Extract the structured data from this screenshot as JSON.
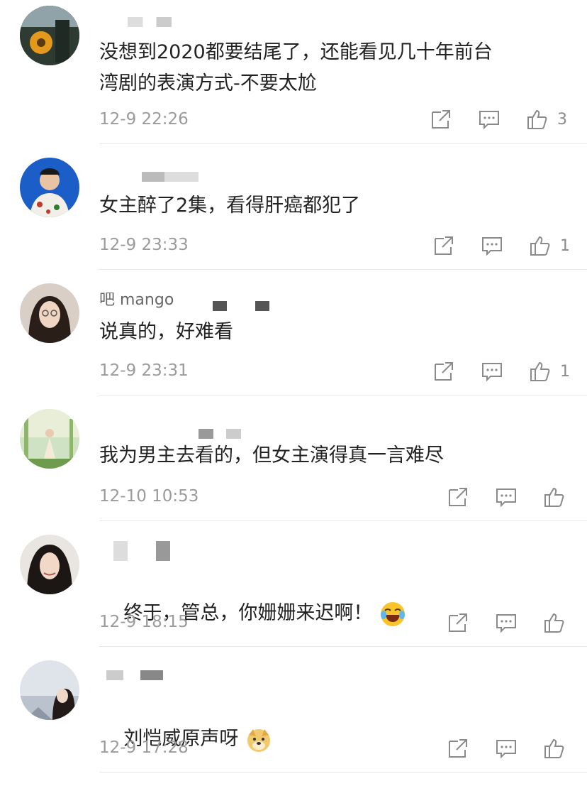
{
  "comments": [
    {
      "text": "没想到2020都要结尾了，还能看见几十年前台\n湾剧的表演方式-不要太尬",
      "time": "12-9 22:26",
      "likes": "3",
      "avatar": "sunflower"
    },
    {
      "text": "女主醉了2集，看得肝癌都犯了",
      "time": "12-9 23:33",
      "likes": "1",
      "avatar": "man"
    },
    {
      "text": "说真的，好难看",
      "time": "12-9 23:31",
      "likes": "1",
      "avatar": "woman-glasses",
      "name_fragment": "吧 mango"
    },
    {
      "text": "我为男主去看的，但女主演得真一言难尽",
      "time": "12-10 10:53",
      "likes": "",
      "avatar": "garden"
    },
    {
      "text": "终于，管总，你姗姗来迟啊！",
      "time": "12-9 18:15",
      "likes": "",
      "avatar": "woman-hair",
      "emoji": "laugh-cry"
    },
    {
      "text": "刘恺威原声呀",
      "time": "12-9 17:28",
      "likes": "",
      "avatar": "woman-outdoor",
      "emoji": "doge"
    }
  ],
  "icons": {
    "share": "share-icon",
    "reply": "comment-icon",
    "like": "thumbs-up-icon"
  },
  "colors": {
    "text": "#222222",
    "meta": "#9b9b9b",
    "icon": "#8a8a8a",
    "divider": "#e8e8e8"
  }
}
